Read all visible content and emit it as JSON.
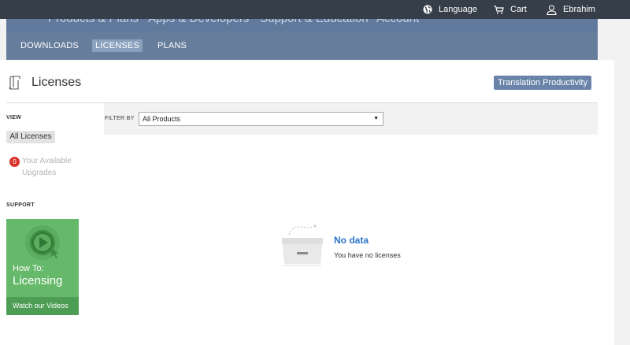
{
  "topbar": {
    "language": "Language",
    "cart": "Cart",
    "user": "Ebrahim"
  },
  "mainnav": [
    "Products & Plans",
    "Apps & Developers",
    "Support & Education",
    "Account"
  ],
  "subnav": {
    "downloads": "DOWNLOADS",
    "licenses": "LICENSES",
    "plans": "PLANS"
  },
  "page": {
    "title": "Licenses",
    "action_button": "Translation Productivity"
  },
  "sidebar": {
    "view_label": "VIEW",
    "all_licenses": "All Licenses",
    "upgrades_count": "0",
    "upgrades_label": "Your Available Upgrades",
    "support_label": "SUPPORT",
    "promo": {
      "howto": "How To:",
      "licensing": "Licensing",
      "watch": "Watch our Videos"
    }
  },
  "filter": {
    "label": "FILTER BY",
    "selected": "All Products"
  },
  "empty": {
    "title": "No data",
    "subtitle": "You have no licenses"
  },
  "colors": {
    "topbar": "#363f49",
    "subnav": "#667d9c",
    "accent_button": "#6a83a8",
    "no_data_title": "#2d73c9",
    "badge": "#d9342b",
    "promo_green": "#66b96b"
  }
}
